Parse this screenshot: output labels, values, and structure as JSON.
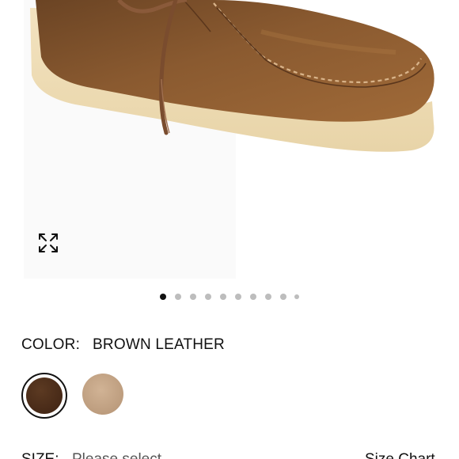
{
  "product_image": {
    "alt": "brown-leather-wallabee-shoe",
    "expand_icon": "expand-arrows-icon"
  },
  "carousel": {
    "total_dots": 10,
    "active_index": 0
  },
  "color": {
    "label": "COLOR:",
    "selected": "BROWN LEATHER"
  },
  "swatches": [
    {
      "name": "brown-leather",
      "color": "#4a2a18",
      "selected": true
    },
    {
      "name": "tan-suede",
      "color": "#c4a586",
      "selected": false
    }
  ],
  "size": {
    "label": "SIZE:",
    "value": "Please select",
    "chart_label": "Size Chart"
  }
}
